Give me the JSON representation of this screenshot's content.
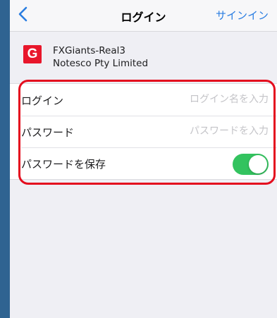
{
  "nav": {
    "back_icon": "chevron-left-icon",
    "title": "ログイン",
    "signin_label": "サインイン"
  },
  "server": {
    "logo_letter": "G",
    "name": "FXGiants-Real3",
    "company": "Notesco Pty Limited"
  },
  "form": {
    "login_label": "ログイン",
    "login_placeholder": "ログイン名を入力",
    "login_value": "",
    "password_label": "パスワード",
    "password_placeholder": "パスワードを入力",
    "password_value": "",
    "save_password_label": "パスワードを保存",
    "save_password_enabled": true
  },
  "colors": {
    "accent": "#2a7de1",
    "toggle_on": "#33c35f",
    "logo_red": "#e8162b",
    "annotation_red": "#e40d1e",
    "side_strip": "#2f6391"
  }
}
